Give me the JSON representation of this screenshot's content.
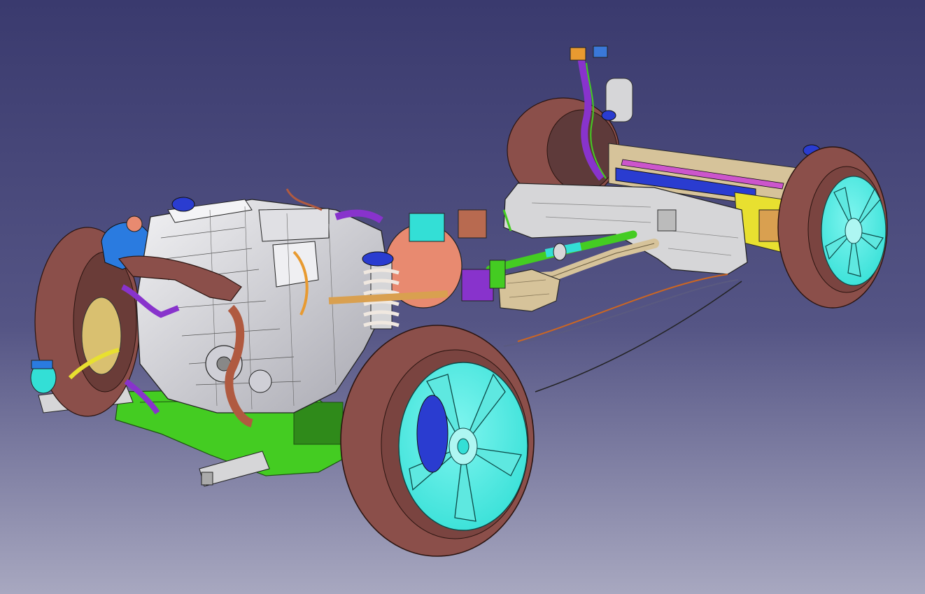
{
  "viewport": {
    "background_top": "#3a3a6e",
    "background_bottom": "#a8a8c0"
  },
  "model": {
    "tire_color": "#8b4f4a",
    "rim_color": "#33dfd6",
    "engine_color": "#d8d8dc",
    "subframe_color": "#44cc22",
    "tank_color": "#d6d6d8",
    "axle_color": "#d6c39a",
    "harness_color": "#8833cc",
    "coolant_color": "#2a7be0",
    "spring_color": "#f0e8e0",
    "cable_color": "#5a5a80"
  }
}
